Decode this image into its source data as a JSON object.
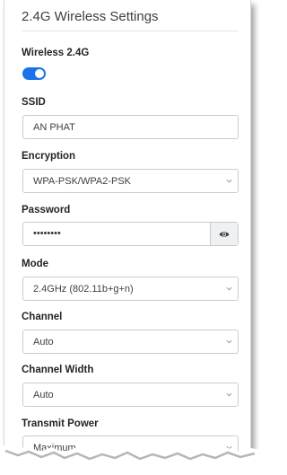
{
  "section_title": "2.4G Wireless Settings",
  "wireless": {
    "label": "Wireless 2.4G",
    "enabled": true
  },
  "ssid": {
    "label": "SSID",
    "value": "AN PHAT"
  },
  "encryption": {
    "label": "Encryption",
    "value": "WPA-PSK/WPA2-PSK"
  },
  "password": {
    "label": "Password",
    "masked_value": "••••••••"
  },
  "mode": {
    "label": "Mode",
    "value": "2.4GHz (802.11b+g+n)"
  },
  "channel": {
    "label": "Channel",
    "value": "Auto"
  },
  "channel_width": {
    "label": "Channel Width",
    "value": "Auto"
  },
  "transmit_power": {
    "label": "Transmit Power",
    "value": "Maximum"
  },
  "colors": {
    "accent": "#1a73e8",
    "border": "#c8ccd0"
  },
  "icons": {
    "password_toggle": "eye-icon",
    "select_arrow": "chevron-down-icon"
  }
}
